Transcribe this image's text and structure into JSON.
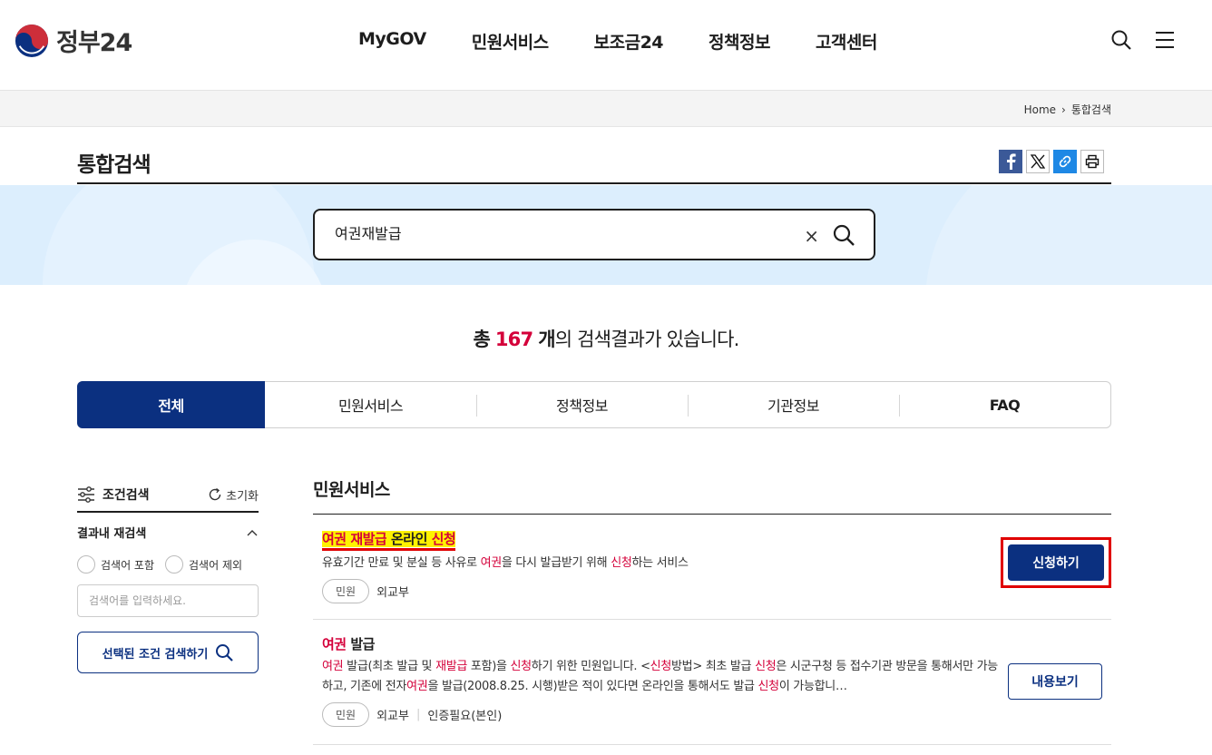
{
  "header": {
    "logo_text": "정부24",
    "nav": [
      "MyGOV",
      "민원서비스",
      "보조금24",
      "정책정보",
      "고객센터"
    ]
  },
  "breadcrumb": {
    "home": "Home",
    "current": "통합검색"
  },
  "page_title": "통합검색",
  "search": {
    "value": "여권재발급",
    "clear": "×"
  },
  "result_count": {
    "prefix": "총",
    "count": "167",
    "unit": "개",
    "suffix": "의 검색결과가 있습니다."
  },
  "tabs": [
    "전체",
    "민원서비스",
    "정책정보",
    "기관정보",
    "FAQ"
  ],
  "sidebar": {
    "title": "조건검색",
    "reset": "초기화",
    "subtitle": "결과내 재검색",
    "radio_include": "검색어 포함",
    "radio_exclude": "검색어 제외",
    "input_placeholder": "검색어를 입력하세요.",
    "search_button": "선택된 조건 검색하기"
  },
  "main": {
    "section_title": "민원서비스",
    "results": [
      {
        "title_parts": [
          "여권",
          " ",
          "재발급",
          " 온라인 ",
          "신청"
        ],
        "desc_parts": [
          "유효기간 만료 및 분실 등 사유로 ",
          "여권",
          "을 다시 발급받기 위해 ",
          "신청",
          "하는 서비스"
        ],
        "badge": "민원",
        "org": "외교부",
        "button": "신청하기"
      },
      {
        "title_parts": [
          "여권",
          " 발급"
        ],
        "desc_parts": [
          "여권",
          " 발급(최초 발급 및 ",
          "재발급",
          " 포함)을 ",
          "신청",
          "하기 위한 민원입니다. <",
          "신청",
          "방법> 최초 발급 ",
          "신청",
          "은 시군구청 등 접수기관 방문을 통해서만 가능하고, 기존에 전자",
          "여권",
          "을 발급(2008.8.25. 시행)받은 적이 있다면 온라인을 통해서도 발급 ",
          "신청",
          "이 가능합니…"
        ],
        "badge": "민원",
        "org": "외교부",
        "extra": "인증필요(본인)",
        "button": "내용보기"
      }
    ]
  },
  "colors": {
    "primary": "#0b3080",
    "highlight": "#d4003a",
    "marker": "#fff200"
  }
}
